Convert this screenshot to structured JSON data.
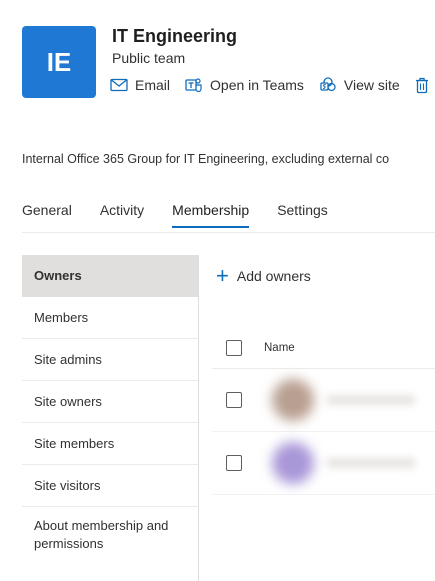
{
  "team": {
    "initials": "IE",
    "name": "IT Engineering",
    "type": "Public team"
  },
  "actions": {
    "email": "Email",
    "open_in_teams": "Open in Teams",
    "view_site": "View site"
  },
  "description": "Internal Office 365 Group for IT Engineering, excluding external co",
  "tabs": [
    "General",
    "Activity",
    "Membership",
    "Settings"
  ],
  "active_tab": "Membership",
  "sidenav": {
    "items": [
      "Owners",
      "Members",
      "Site admins",
      "Site owners",
      "Site members",
      "Site visitors",
      "About membership and permissions"
    ],
    "active": "Owners"
  },
  "add_owners_label": "Add owners",
  "table": {
    "name_header": "Name"
  },
  "colors": {
    "tile": "#1e78d4",
    "accent": "#0f6cbd"
  }
}
